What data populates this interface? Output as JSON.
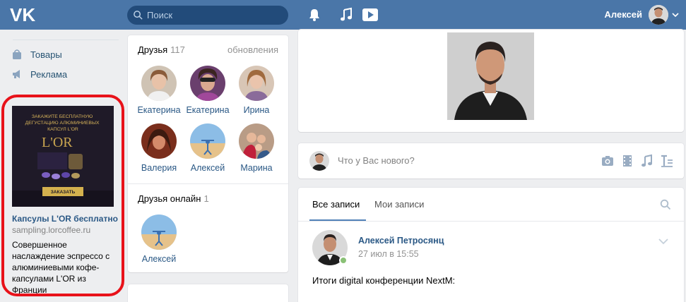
{
  "header": {
    "search_placeholder": "Поиск",
    "user_name": "Алексей"
  },
  "left_menu": {
    "items": [
      {
        "label": "Товары",
        "icon": "bag-icon"
      },
      {
        "label": "Реклама",
        "icon": "megaphone-icon"
      }
    ]
  },
  "ad": {
    "image_headline": "ЗАКАЖИТЕ БЕСПЛАТНУЮ ДЕГУСТАЦИЮ АЛЮМИНИЕВЫХ КАПСУЛ L'OR",
    "image_button": "ЗАКАЗАТЬ",
    "title": "Капсулы L'OR бесплатно",
    "domain": "sampling.lorcoffee.ru",
    "text": "Совершенное наслаждение эспрессо с алюминиевыми кофе-капсулами L'OR из Франции"
  },
  "friends": {
    "title": "Друзья",
    "count": "117",
    "updates_link": "обновления",
    "list": [
      {
        "name": "Екатерина"
      },
      {
        "name": "Екатерина"
      },
      {
        "name": "Ирина"
      },
      {
        "name": "Валерия"
      },
      {
        "name": "Алексей"
      },
      {
        "name": "Марина"
      }
    ],
    "online_title": "Друзья онлайн",
    "online_count": "1",
    "online_list": [
      {
        "name": "Алексей"
      }
    ]
  },
  "post_composer": {
    "placeholder": "Что у Вас нового?"
  },
  "feed": {
    "tabs": [
      {
        "label": "Все записи",
        "active": true
      },
      {
        "label": "Мои записи",
        "active": false
      }
    ],
    "post": {
      "author": "Алексей Петросянц",
      "date": "27 июл в 15:55",
      "text": "Итоги digital конференции NextM:"
    }
  },
  "colors": {
    "header": "#4a76a8",
    "link": "#2a5885",
    "highlight_ring": "#e8121a",
    "online": "#8ac176"
  }
}
